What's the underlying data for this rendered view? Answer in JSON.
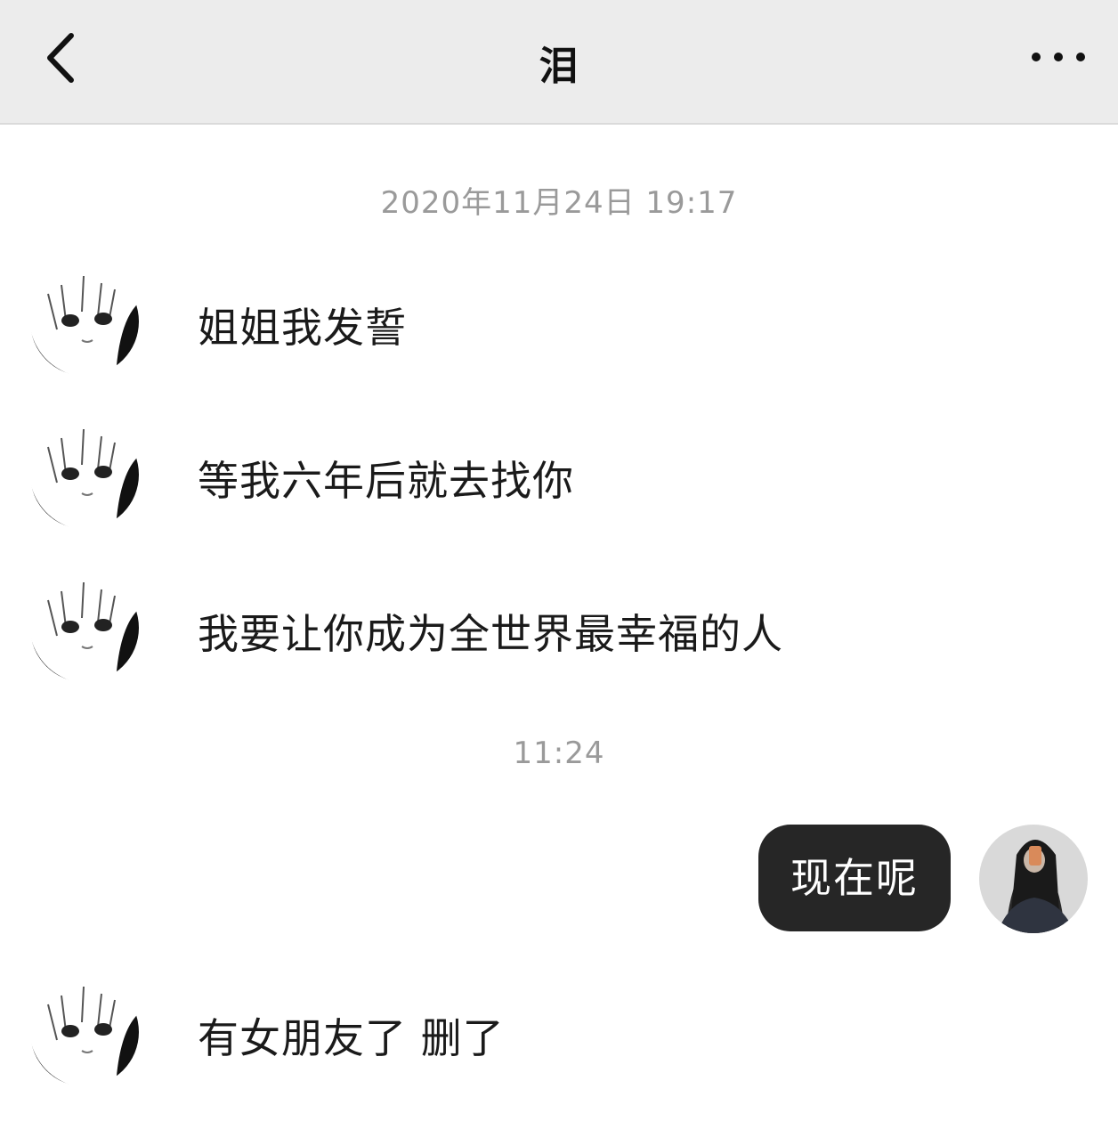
{
  "header": {
    "back_icon": "chevron-left-icon",
    "title": "泪",
    "more_icon": "more-dots-icon"
  },
  "timestamps": [
    "2020年11月24日 19:17",
    "11:24"
  ],
  "messages": [
    {
      "sender": "contact",
      "text": "姐姐我发誓"
    },
    {
      "sender": "contact",
      "text": "等我六年后就去找你"
    },
    {
      "sender": "contact",
      "text": "我要让你成为全世界最幸福的人"
    },
    {
      "sender": "self",
      "text": "现在呢"
    },
    {
      "sender": "contact",
      "text": "有女朋友了 删了"
    }
  ],
  "colors": {
    "header_bg": "#ececec",
    "outgoing_bubble": "#262626",
    "timestamp_text": "#9a9a9a"
  }
}
